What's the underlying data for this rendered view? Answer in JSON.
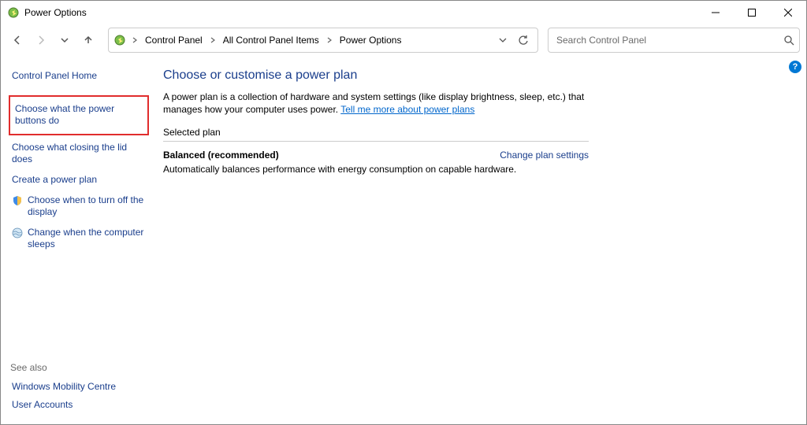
{
  "window": {
    "title": "Power Options"
  },
  "breadcrumbs": {
    "items": [
      "Control Panel",
      "All Control Panel Items",
      "Power Options"
    ]
  },
  "search": {
    "placeholder": "Search Control Panel"
  },
  "sidebar": {
    "home": "Control Panel Home",
    "links": [
      {
        "label": "Choose what the power buttons do",
        "highlighted": true,
        "icon": null
      },
      {
        "label": "Choose what closing the lid does",
        "highlighted": false,
        "icon": null
      },
      {
        "label": "Create a power plan",
        "highlighted": false,
        "icon": null
      },
      {
        "label": "Choose when to turn off the display",
        "highlighted": false,
        "icon": "shield"
      },
      {
        "label": "Change when the computer sleeps",
        "highlighted": false,
        "icon": "globe"
      }
    ],
    "see_also_label": "See also",
    "see_also": [
      "Windows Mobility Centre",
      "User Accounts"
    ]
  },
  "main": {
    "heading": "Choose or customise a power plan",
    "description_pre": "A power plan is a collection of hardware and system settings (like display brightness, sleep, etc.) that manages how your computer uses power. ",
    "description_link": "Tell me more about power plans",
    "section_label": "Selected plan",
    "plan_name": "Balanced (recommended)",
    "plan_settings_link": "Change plan settings",
    "plan_description": "Automatically balances performance with energy consumption on capable hardware."
  },
  "help_tooltip": "?"
}
